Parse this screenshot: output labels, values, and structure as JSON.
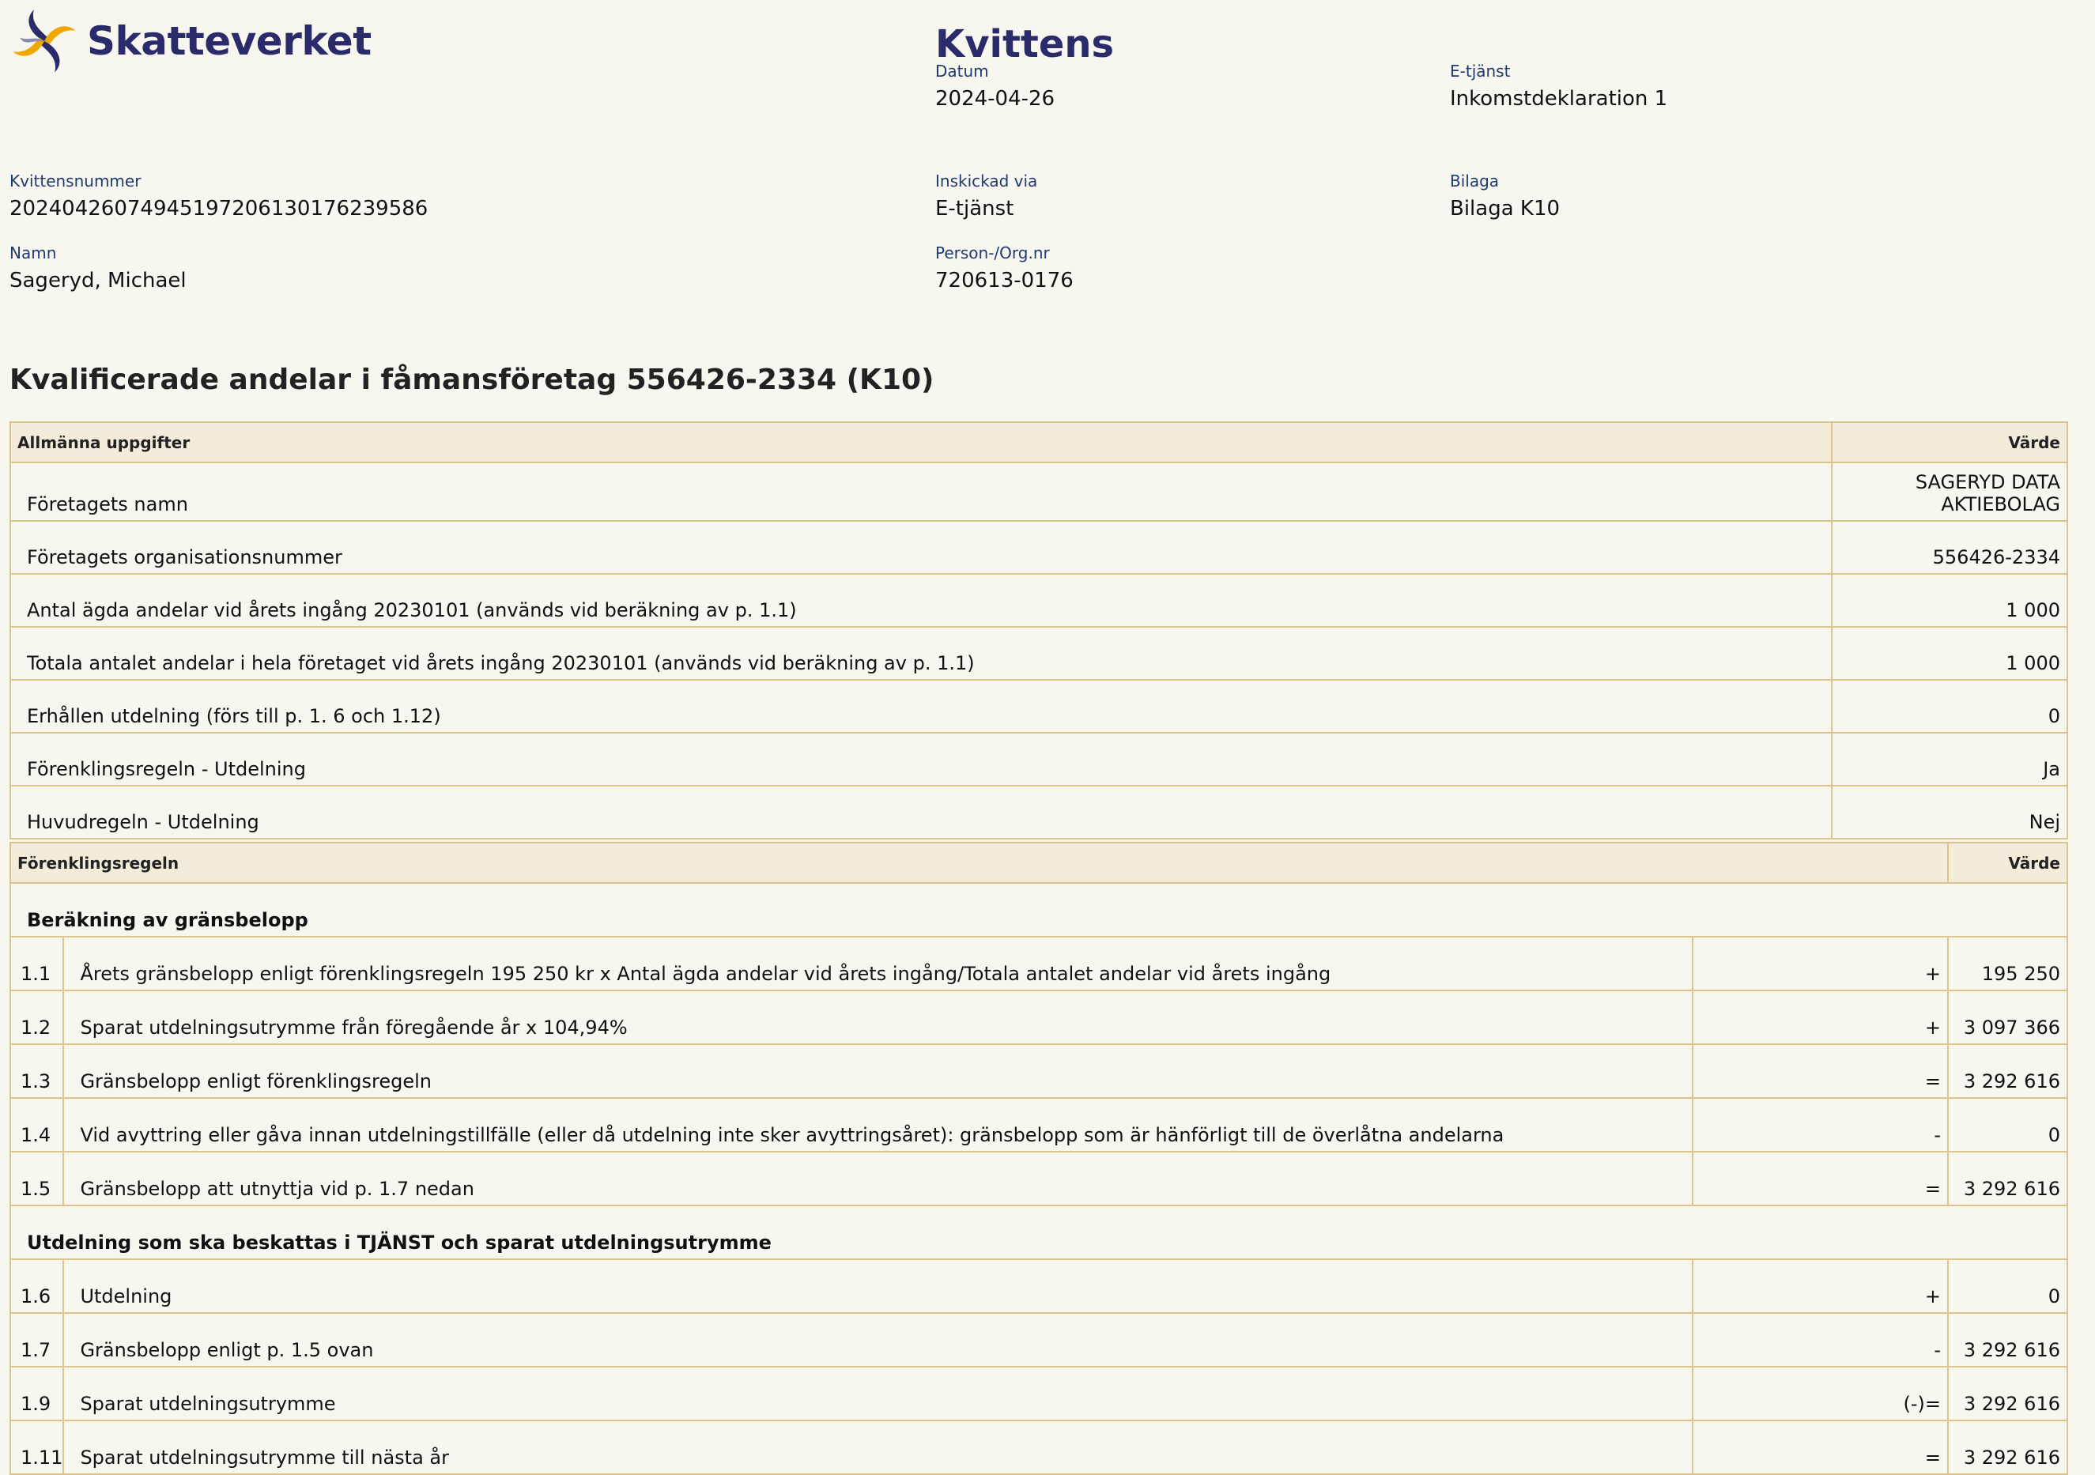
{
  "brand": {
    "name": "Skatteverket",
    "colors": {
      "primary": "#2b2b6b",
      "accent": "#f0a800"
    }
  },
  "header": {
    "title": "Kvittens",
    "datum_label": "Datum",
    "datum": "2024-04-26",
    "etjanst_label": "E-tjänst",
    "etjanst": "Inkomstdeklaration 1",
    "kvittensnummer_label": "Kvittensnummer",
    "kvittensnummer": "20240426074945197206130176239586",
    "inskickad_label": "Inskickad via",
    "inskickad": "E-tjänst",
    "bilaga_label": "Bilaga",
    "bilaga": "Bilaga K10",
    "namn_label": "Namn",
    "namn": "Sageryd, Michael",
    "personnr_label": "Person-/Org.nr",
    "personnr": "720613-0176"
  },
  "section_title": "Kvalificerade andelar i fåmansföretag 556426-2334 (K10)",
  "allmanna": {
    "header": "Allmänna uppgifter",
    "value_header": "Värde",
    "rows": [
      {
        "label": "Företagets namn",
        "value": "SAGERYD DATA AKTIEBOLAG"
      },
      {
        "label": "Företagets organisationsnummer",
        "value": "556426-2334"
      },
      {
        "label": "Antal ägda andelar vid årets ingång 20230101 (används vid beräkning av p. 1.1)",
        "value": "1 000"
      },
      {
        "label": "Totala antalet andelar i hela företaget vid årets ingång 20230101 (används vid beräkning av p. 1.1)",
        "value": "1 000"
      },
      {
        "label": "Erhållen utdelning (förs till p. 1. 6 och 1.12)",
        "value": "0"
      },
      {
        "label": "Förenklingsregeln - Utdelning",
        "value": "Ja"
      },
      {
        "label": "Huvudregeln - Utdelning",
        "value": "Nej"
      }
    ]
  },
  "forenkling": {
    "header": "Förenklingsregeln",
    "value_header": "Värde",
    "sub1": "Beräkning av gränsbelopp",
    "rows1": [
      {
        "num": "1.1",
        "desc": "Årets gränsbelopp enligt förenklingsregeln 195 250 kr x Antal ägda andelar vid årets ingång/Totala antalet andelar vid årets ingång",
        "op": "+",
        "value": "195 250"
      },
      {
        "num": "1.2",
        "desc": "Sparat utdelningsutrymme från föregående år x 104,94%",
        "op": "+",
        "value": "3 097 366"
      },
      {
        "num": "1.3",
        "desc": "Gränsbelopp enligt förenklingsregeln",
        "op": "=",
        "value": "3 292 616"
      },
      {
        "num": "1.4",
        "desc": "Vid avyttring eller gåva innan utdelningstillfälle (eller då utdelning inte sker avyttringsåret): gränsbelopp som är hänförligt till de överlåtna andelarna",
        "op": "-",
        "value": "0"
      },
      {
        "num": "1.5",
        "desc": "Gränsbelopp att utnyttja vid p. 1.7 nedan",
        "op": "=",
        "value": "3 292 616"
      }
    ],
    "sub2": "Utdelning som ska beskattas i TJÄNST och sparat utdelningsutrymme",
    "rows2": [
      {
        "num": "1.6",
        "desc": "Utdelning",
        "op": "+",
        "value": "0"
      },
      {
        "num": "1.7",
        "desc": "Gränsbelopp enligt p. 1.5 ovan",
        "op": "-",
        "value": "3 292 616"
      },
      {
        "num": "1.9",
        "desc": "Sparat utdelningsutrymme",
        "op": "(-)=",
        "value": "3 292 616"
      },
      {
        "num": "1.11",
        "desc": "Sparat utdelningsutrymme till nästa år",
        "op": "=",
        "value": "3 292 616"
      }
    ]
  }
}
